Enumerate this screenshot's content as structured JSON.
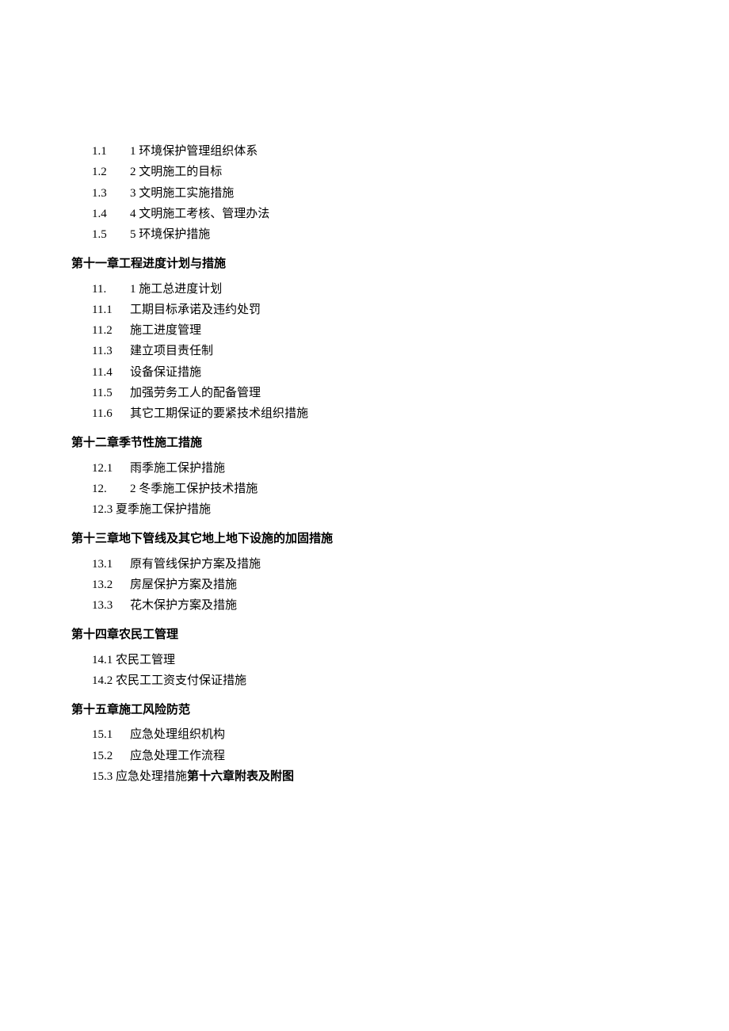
{
  "items": [
    {
      "num": "1.1",
      "label": "1 环境保护管理组织体系",
      "indent": true
    },
    {
      "num": "1.2",
      "label": "2 文明施工的目标",
      "indent": true
    },
    {
      "num": "1.3",
      "label": "3 文明施工实施措施",
      "indent": true
    },
    {
      "num": "1.4",
      "label": "4 文明施工考核、管理办法",
      "indent": true
    },
    {
      "num": "1.5",
      "label": "5 环境保护措施",
      "indent": true
    }
  ],
  "ch11": {
    "title": "第十一章工程进度计划与措施",
    "items": [
      {
        "num": "11.",
        "label": "1 施工总进度计划"
      },
      {
        "num": "11.1",
        "label": "工期目标承诺及违约处罚"
      },
      {
        "num": "11.2",
        "label": "施工进度管理"
      },
      {
        "num": "11.3",
        "label": "建立项目责任制"
      },
      {
        "num": "11.4",
        "label": "设备保证措施"
      },
      {
        "num": "11.5",
        "label": "加强劳务工人的配备管理"
      },
      {
        "num": "11.6",
        "label": "其它工期保证的要紧技术组织措施"
      }
    ]
  },
  "ch12": {
    "title": "第十二章季节性施工措施",
    "items": [
      {
        "num": "12.1",
        "label": "雨季施工保护措施"
      },
      {
        "num": "12.",
        "label": "2 冬季施工保护技术措施"
      },
      {
        "num": "12.3",
        "label": "夏季施工保护措施",
        "tight": true
      }
    ]
  },
  "ch13": {
    "title": "第十三章地下管线及其它地上地下设施的加固措施",
    "items": [
      {
        "num": "13.1",
        "label": "原有管线保护方案及措施"
      },
      {
        "num": "13.2",
        "label": "房屋保护方案及措施"
      },
      {
        "num": "13.3",
        "label": "花木保护方案及措施"
      }
    ]
  },
  "ch14": {
    "title": "第十四章农民工管理",
    "items": [
      {
        "num": "14.1",
        "label": "农民工管理",
        "tight": true
      },
      {
        "num": "14.2",
        "label": "农民工工资支付保证措施",
        "tight": true
      }
    ]
  },
  "ch15": {
    "title": "第十五章施工风险防范",
    "items": [
      {
        "num": "15.1",
        "label": "应急处理组织机构"
      },
      {
        "num": "15.2",
        "label": "应急处理工作流程"
      }
    ],
    "last": {
      "num": "15.3",
      "label": "应急处理措施",
      "bold": "第十六章附表及附图"
    }
  }
}
